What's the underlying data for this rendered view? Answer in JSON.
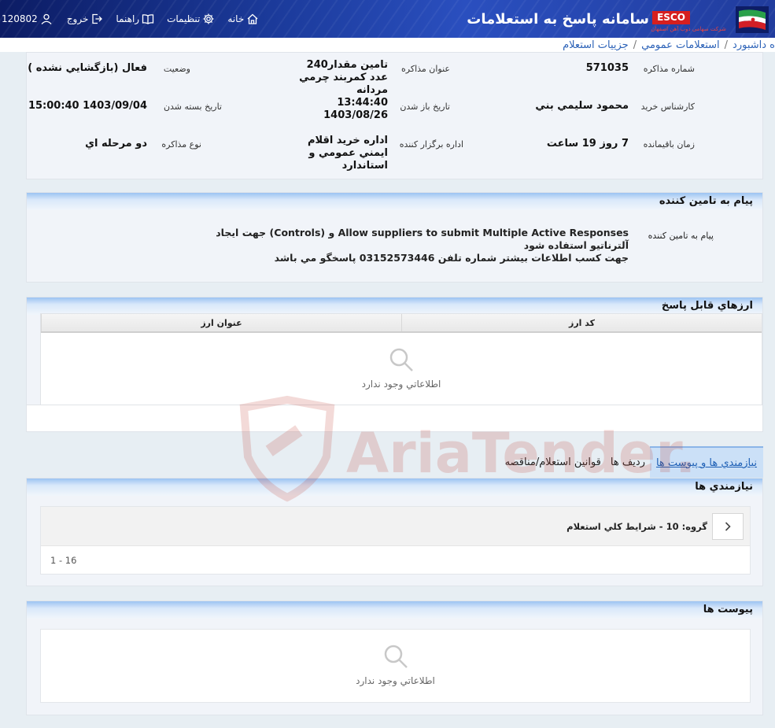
{
  "header": {
    "app_title": "سامانه پاسخ به استعلامات",
    "logo_text": "ESCO",
    "logo_subtitle": "شرکت سهامی ذوب آهن اصفهان",
    "nav": {
      "home": "خانه",
      "settings": "تنظيمات",
      "help": "راهنما",
      "logout": "خروج",
      "user_id": "120802"
    }
  },
  "breadcrumb": [
    "ه داشبورد",
    "استعلامات عمومي",
    "جزييات استعلام"
  ],
  "info": {
    "negotiation_no_label": "شماره مذاکره",
    "negotiation_no": "571035",
    "title_label": "عنوان مذاکره",
    "title": "تامين مقدار240 عدد كمربند چرمي مردانه",
    "status_label": "وضعيت",
    "status": "فعال (بازگشايي نشده )",
    "buyer_label": "کارشناس خريد",
    "buyer": "محمود سليمي بني",
    "open_date_label": "تاريخ باز شدن",
    "open_date": "13:44:40 1403/08/26",
    "close_date_label": "تاريخ بسته شدن",
    "close_date": "1403/09/04 15:00:40",
    "remaining_label": "زمان باقيمانده",
    "remaining": "7 روز 19 ساعت",
    "organizer_label": "اداره برگزار کننده",
    "organizer": "اداره خريد اقلام ايمني عمومي و استاندارد",
    "type_label": "نوع مذاکره",
    "type": "دو مرحله اي"
  },
  "message": {
    "header": "پيام به تامين کننده",
    "label": "پيام به تامين کننده",
    "line1": "Allow suppliers to submit Multiple Active Responses و (Controls) جهت ايجاد آلترناتيو استفاده شود",
    "line2": "جهت کسب اطلاعات بيشتر شماره تلفن 03152573446 پاسخگو مي باشد"
  },
  "currencies": {
    "header": "ارزهاي قابل پاسخ",
    "columns": [
      "کد ارز",
      "عنوان ارز"
    ],
    "empty": "اطلاعاتي وجود ندارد"
  },
  "tabs": [
    "نيازمندي ها و پيوست ها",
    "رديف ها",
    "قوانين استعلام/مناقصه"
  ],
  "needs": {
    "header": "نيازمندي ها",
    "group": "گروه: 10 - شرايط کلي استعلام",
    "pager": "1 - 16"
  },
  "attachments": {
    "header": "پيوست ها",
    "empty": "اطلاعاتي وجود ندارد"
  },
  "watermark_text": "AriaTender.neT",
  "colors": {
    "header_dark": "#0c1c64",
    "header_accent": "#2a4fbf",
    "link": "#2d63b8",
    "logo_red": "#d61f1f",
    "watermark": "#c0392b"
  }
}
